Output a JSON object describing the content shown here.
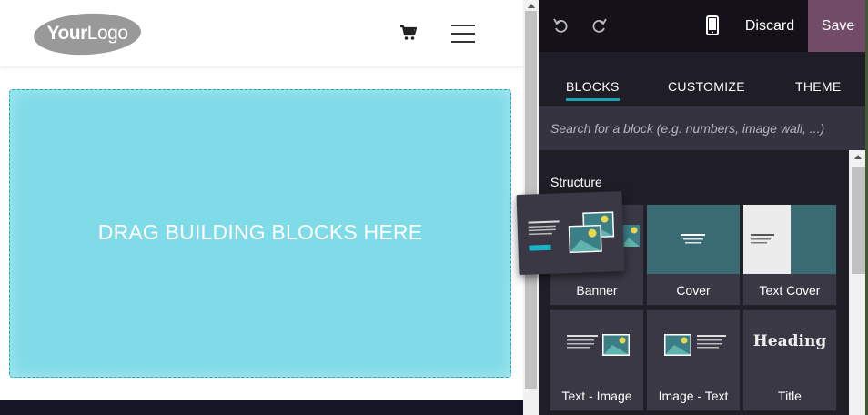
{
  "site": {
    "logo": {
      "text_bold": "Your",
      "text_light": "Logo"
    },
    "header_icons": [
      "shopping-cart-icon",
      "hamburger-menu-icon"
    ],
    "dropzone_label": "DRAG BUILDING BLOCKS HERE"
  },
  "editor": {
    "toolbar": {
      "undo_icon": "undo-icon",
      "redo_icon": "redo-icon",
      "mobile_icon": "mobile-preview-icon",
      "discard_label": "Discard",
      "save_label": "Save"
    },
    "tabs": [
      {
        "label": "BLOCKS",
        "active": true
      },
      {
        "label": "CUSTOMIZE",
        "active": false
      },
      {
        "label": "THEME",
        "active": false
      }
    ],
    "search": {
      "placeholder": "Search for a block (e.g. numbers, image wall, ...)",
      "value": ""
    },
    "section_title": "Structure",
    "blocks": [
      {
        "label": "Banner"
      },
      {
        "label": "Cover"
      },
      {
        "label": "Text Cover"
      },
      {
        "label": "Text - Image"
      },
      {
        "label": "Image - Text"
      },
      {
        "label": "Title",
        "thumb_text": "Heading"
      }
    ]
  },
  "colors": {
    "accent": "#17a2b8",
    "save_button": "#714b67",
    "dropzone": "#7fdbe8",
    "panel_bg": "#1f1d26"
  }
}
